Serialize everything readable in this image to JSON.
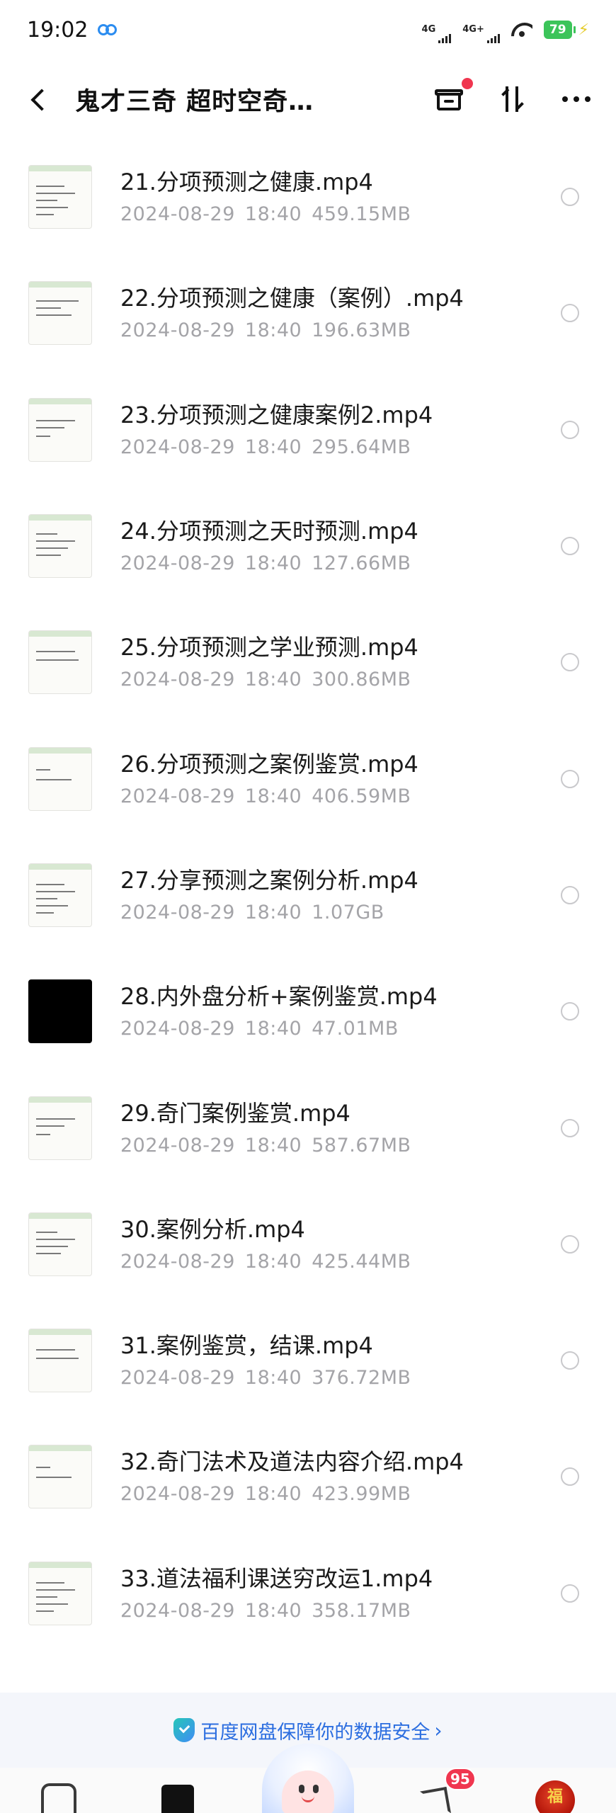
{
  "status_bar": {
    "time": "19:02",
    "network_1": "4G",
    "network_2": "4G+",
    "battery": "79"
  },
  "header": {
    "title": "鬼才三奇 超时空奇…",
    "back_icon": "chevron-left-icon",
    "actions": [
      "archive-icon",
      "sort-icon",
      "more-icon"
    ]
  },
  "files": [
    {
      "name": "21.分项预测之健康.mp4",
      "date": "2024-08-29",
      "time": "18:40",
      "size": "459.15MB",
      "thumb": "light"
    },
    {
      "name": "22.分项预测之健康（案例）.mp4",
      "date": "2024-08-29",
      "time": "18:40",
      "size": "196.63MB",
      "thumb": "light"
    },
    {
      "name": "23.分项预测之健康案例2.mp4",
      "date": "2024-08-29",
      "time": "18:40",
      "size": "295.64MB",
      "thumb": "light"
    },
    {
      "name": "24.分项预测之天时预测.mp4",
      "date": "2024-08-29",
      "time": "18:40",
      "size": "127.66MB",
      "thumb": "light"
    },
    {
      "name": "25.分项预测之学业预测.mp4",
      "date": "2024-08-29",
      "time": "18:40",
      "size": "300.86MB",
      "thumb": "light"
    },
    {
      "name": "26.分项预测之案例鉴赏.mp4",
      "date": "2024-08-29",
      "time": "18:40",
      "size": "406.59MB",
      "thumb": "light"
    },
    {
      "name": "27.分享预测之案例分析.mp4",
      "date": "2024-08-29",
      "time": "18:40",
      "size": "1.07GB",
      "thumb": "light"
    },
    {
      "name": "28.内外盘分析+案例鉴赏.mp4",
      "date": "2024-08-29",
      "time": "18:40",
      "size": "47.01MB",
      "thumb": "dark"
    },
    {
      "name": "29.奇门案例鉴赏.mp4",
      "date": "2024-08-29",
      "time": "18:40",
      "size": "587.67MB",
      "thumb": "light"
    },
    {
      "name": "30.案例分析.mp4",
      "date": "2024-08-29",
      "time": "18:40",
      "size": "425.44MB",
      "thumb": "light"
    },
    {
      "name": "31.案例鉴赏，结课.mp4",
      "date": "2024-08-29",
      "time": "18:40",
      "size": "376.72MB",
      "thumb": "light"
    },
    {
      "name": "32.奇门法术及道法内容介绍.mp4",
      "date": "2024-08-29",
      "time": "18:40",
      "size": "423.99MB",
      "thumb": "light"
    },
    {
      "name": "33.道法福利课送穷改运1.mp4",
      "date": "2024-08-29",
      "time": "18:40",
      "size": "358.17MB",
      "thumb": "light"
    }
  ],
  "security_banner": {
    "text": "百度网盘保障你的数据安全",
    "chevron": "›"
  },
  "bottom_nav": {
    "badge_count": "95",
    "avatar_text": "福"
  },
  "colors": {
    "accent": "#2c6ee0",
    "badge": "#f0364f",
    "battery": "#3cc45a",
    "meta_text": "#a4a4a8"
  }
}
